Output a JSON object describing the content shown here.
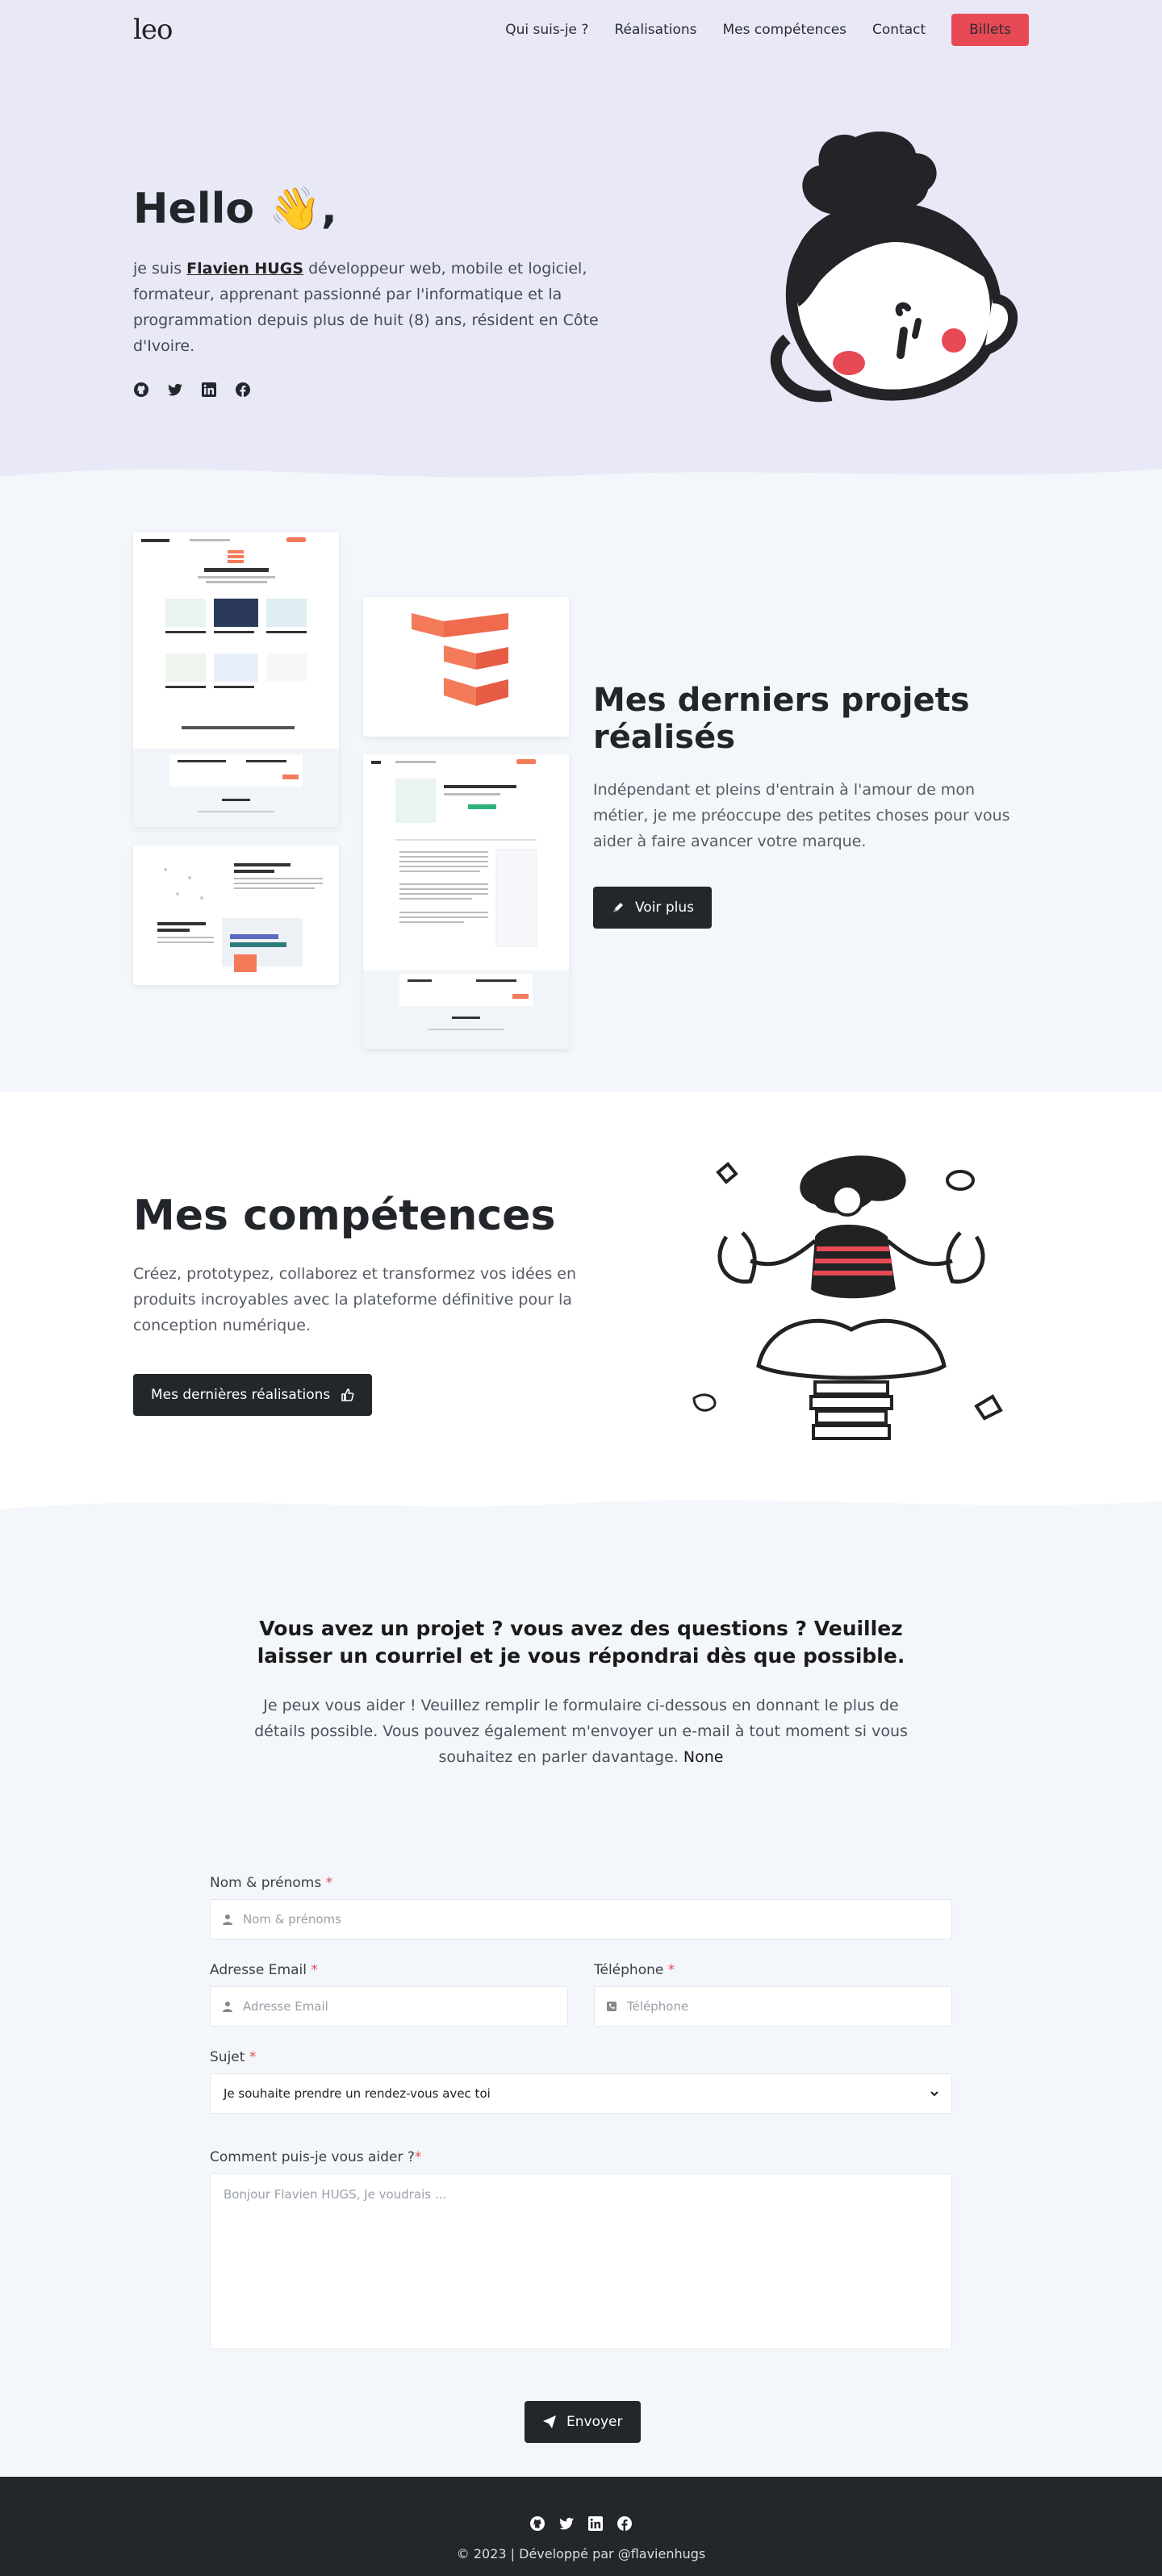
{
  "nav": {
    "brand": "leo",
    "items": [
      "Qui suis-je ?",
      "Réalisations",
      "Mes compétences",
      "Contact"
    ],
    "cta": "Billets"
  },
  "hero": {
    "title": "Hello 👋,",
    "intro_before": "je suis ",
    "name": "Flavien HUGS",
    "intro_after": " développeur web, mobile et logiciel, formateur, apprenant passionné par l'informatique et la programmation depuis plus de huit (8) ans, résident en Côte d'Ivoire.",
    "socials": [
      "github-icon",
      "twitter-icon",
      "linkedin-icon",
      "facebook-icon"
    ]
  },
  "projects": {
    "title": "Mes derniers projets réalisés",
    "text": "Indépendant et pleins d'entrain à l'amour de mon métier, je me préoccupe des petites choses pour vous aider à faire avancer votre marque.",
    "button": "Voir plus"
  },
  "skills": {
    "title": "Mes compétences",
    "text": "Créez, prototypez, collaborez et transformez vos idées en produits incroyables avec la plateforme définitive pour la conception numérique.",
    "button": "Mes dernières réalisations"
  },
  "contact": {
    "title": "Vous avez un projet ? vous avez des questions ? Veuillez laisser un courriel et je vous répondrai dès que possible.",
    "subtitle": "Je peux vous aider ! Veuillez remplir le formulaire ci-dessous en donnant le plus de détails possible. Vous pouvez également m'envoyer un e-mail à tout moment si vous souhaitez en parler davantage.",
    "subtitle_extra": "None",
    "name_label": "Nom & prénoms",
    "name_placeholder": "Nom & prénoms",
    "email_label": "Adresse Email",
    "email_placeholder": "Adresse Email",
    "phone_label": "Téléphone",
    "phone_placeholder": "Téléphone",
    "subject_label": "Sujet",
    "subject_value": "Je souhaite prendre un rendez-vous avec toi",
    "message_label": "Comment puis-je vous aider ?",
    "message_placeholder": "Bonjour Flavien HUGS, Je voudrais ...",
    "required_mark": "*",
    "send": "Envoyer"
  },
  "footer": {
    "socials": [
      "github-icon",
      "twitter-icon",
      "linkedin-icon",
      "facebook-icon"
    ],
    "copyright": "© 2023 | Développé par @flavienhugs"
  },
  "colors": {
    "accent": "#e84a55",
    "dark": "#23262b",
    "hero_bg": "#e8e8f7",
    "section_bg": "#f3f6fa"
  }
}
